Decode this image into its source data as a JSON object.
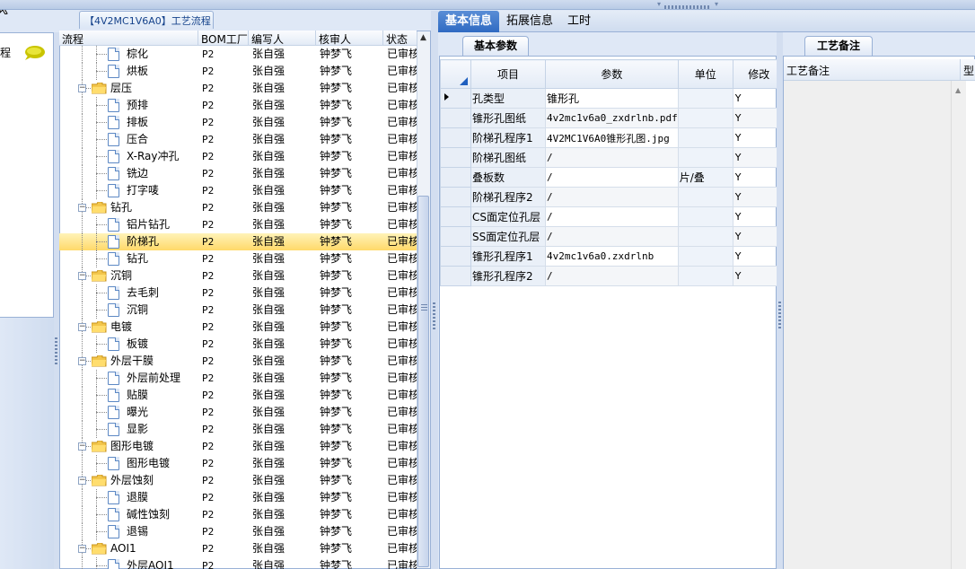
{
  "tree": {
    "title": "【4V2MC1V6A0】工艺流程",
    "columns": [
      "流程",
      "BOM工厂",
      "编写人",
      "核审人",
      "状态"
    ],
    "rows": [
      {
        "name": "棕化",
        "level": 2,
        "bom": "P2",
        "writer": "张自强",
        "reviewer": "钟梦飞",
        "status": "已审核"
      },
      {
        "name": "烘板",
        "level": 2,
        "bom": "P2",
        "writer": "张自强",
        "reviewer": "钟梦飞",
        "status": "已审核"
      },
      {
        "name": "层压",
        "level": 1,
        "bom": "P2",
        "writer": "张自强",
        "reviewer": "钟梦飞",
        "status": "已审核"
      },
      {
        "name": "预排",
        "level": 2,
        "bom": "P2",
        "writer": "张自强",
        "reviewer": "钟梦飞",
        "status": "已审核"
      },
      {
        "name": "排板",
        "level": 2,
        "bom": "P2",
        "writer": "张自强",
        "reviewer": "钟梦飞",
        "status": "已审核"
      },
      {
        "name": "压合",
        "level": 2,
        "bom": "P2",
        "writer": "张自强",
        "reviewer": "钟梦飞",
        "status": "已审核"
      },
      {
        "name": "X-Ray冲孔",
        "level": 2,
        "bom": "P2",
        "writer": "张自强",
        "reviewer": "钟梦飞",
        "status": "已审核"
      },
      {
        "name": "铣边",
        "level": 2,
        "bom": "P2",
        "writer": "张自强",
        "reviewer": "钟梦飞",
        "status": "已审核"
      },
      {
        "name": "打字唛",
        "level": 2,
        "bom": "P2",
        "writer": "张自强",
        "reviewer": "钟梦飞",
        "status": "已审核"
      },
      {
        "name": "钻孔",
        "level": 1,
        "bom": "P2",
        "writer": "张自强",
        "reviewer": "钟梦飞",
        "status": "已审核"
      },
      {
        "name": "铝片钻孔",
        "level": 2,
        "bom": "P2",
        "writer": "张自强",
        "reviewer": "钟梦飞",
        "status": "已审核"
      },
      {
        "name": "阶梯孔",
        "level": 2,
        "bom": "P2",
        "writer": "张自强",
        "reviewer": "钟梦飞",
        "status": "已审核",
        "selected": true
      },
      {
        "name": "钻孔",
        "level": 2,
        "bom": "P2",
        "writer": "张自强",
        "reviewer": "钟梦飞",
        "status": "已审核"
      },
      {
        "name": "沉铜",
        "level": 1,
        "bom": "P2",
        "writer": "张自强",
        "reviewer": "钟梦飞",
        "status": "已审核"
      },
      {
        "name": "去毛刺",
        "level": 2,
        "bom": "P2",
        "writer": "张自强",
        "reviewer": "钟梦飞",
        "status": "已审核"
      },
      {
        "name": "沉铜",
        "level": 2,
        "bom": "P2",
        "writer": "张自强",
        "reviewer": "钟梦飞",
        "status": "已审核"
      },
      {
        "name": "电镀",
        "level": 1,
        "bom": "P2",
        "writer": "张自强",
        "reviewer": "钟梦飞",
        "status": "已审核"
      },
      {
        "name": "板镀",
        "level": 2,
        "bom": "P2",
        "writer": "张自强",
        "reviewer": "钟梦飞",
        "status": "已审核"
      },
      {
        "name": "外层干膜",
        "level": 1,
        "bom": "P2",
        "writer": "张自强",
        "reviewer": "钟梦飞",
        "status": "已审核"
      },
      {
        "name": "外层前处理",
        "level": 2,
        "bom": "P2",
        "writer": "张自强",
        "reviewer": "钟梦飞",
        "status": "已审核"
      },
      {
        "name": "贴膜",
        "level": 2,
        "bom": "P2",
        "writer": "张自强",
        "reviewer": "钟梦飞",
        "status": "已审核"
      },
      {
        "name": "曝光",
        "level": 2,
        "bom": "P2",
        "writer": "张自强",
        "reviewer": "钟梦飞",
        "status": "已审核"
      },
      {
        "name": "显影",
        "level": 2,
        "bom": "P2",
        "writer": "张自强",
        "reviewer": "钟梦飞",
        "status": "已审核"
      },
      {
        "name": "图形电镀",
        "level": 1,
        "bom": "P2",
        "writer": "张自强",
        "reviewer": "钟梦飞",
        "status": "已审核"
      },
      {
        "name": "图形电镀",
        "level": 2,
        "bom": "P2",
        "writer": "张自强",
        "reviewer": "钟梦飞",
        "status": "已审核"
      },
      {
        "name": "外层蚀刻",
        "level": 1,
        "bom": "P2",
        "writer": "张自强",
        "reviewer": "钟梦飞",
        "status": "已审核"
      },
      {
        "name": "退膜",
        "level": 2,
        "bom": "P2",
        "writer": "张自强",
        "reviewer": "钟梦飞",
        "status": "已审核"
      },
      {
        "name": "碱性蚀刻",
        "level": 2,
        "bom": "P2",
        "writer": "张自强",
        "reviewer": "钟梦飞",
        "status": "已审核"
      },
      {
        "name": "退锡",
        "level": 2,
        "bom": "P2",
        "writer": "张自强",
        "reviewer": "钟梦飞",
        "status": "已审核"
      },
      {
        "name": "AOI1",
        "level": 1,
        "bom": "P2",
        "writer": "张自强",
        "reviewer": "钟梦飞",
        "status": "已审核"
      },
      {
        "name": "外层AOI1",
        "level": 2,
        "bom": "P2",
        "writer": "张自强",
        "reviewer": "钟梦飞",
        "status": "已审核"
      }
    ]
  },
  "left": {
    "label": "程"
  },
  "tabs": [
    "基本信息",
    "拓展信息",
    "工时"
  ],
  "params": {
    "tab_label": "基本参数",
    "columns": [
      "项目",
      "参数",
      "单位",
      "修改"
    ],
    "rows": [
      {
        "item": "孔类型",
        "value": "锥形孔",
        "unit": "",
        "mod": "Y"
      },
      {
        "item": "锥形孔图纸",
        "value": "4v2mc1v6a0_zxdrlnb.pdf",
        "unit": "",
        "mod": "Y"
      },
      {
        "item": "阶梯孔程序1",
        "value": "4V2MC1V6A0锥形孔图.jpg",
        "unit": "",
        "mod": "Y"
      },
      {
        "item": "阶梯孔图纸",
        "value": "/",
        "unit": "",
        "mod": "Y"
      },
      {
        "item": "叠板数",
        "value": "/",
        "unit": "片/叠",
        "mod": "Y"
      },
      {
        "item": "阶梯孔程序2",
        "value": "/",
        "unit": "",
        "mod": "Y"
      },
      {
        "item": "CS面定位孔层",
        "value": "/",
        "unit": "",
        "mod": "Y"
      },
      {
        "item": "SS面定位孔层",
        "value": "/",
        "unit": "",
        "mod": "Y"
      },
      {
        "item": "锥形孔程序1",
        "value": "4v2mc1v6a0.zxdrlnb",
        "unit": "",
        "mod": "Y"
      },
      {
        "item": "锥形孔程序2",
        "value": "/",
        "unit": "",
        "mod": "Y"
      }
    ]
  },
  "notes": {
    "tab_label": "工艺备注",
    "col1": "工艺备注",
    "col2": "型"
  },
  "colors": {
    "accent": "#2f6ac2",
    "selection": "#ffd96a",
    "border": "#99b1d6"
  }
}
